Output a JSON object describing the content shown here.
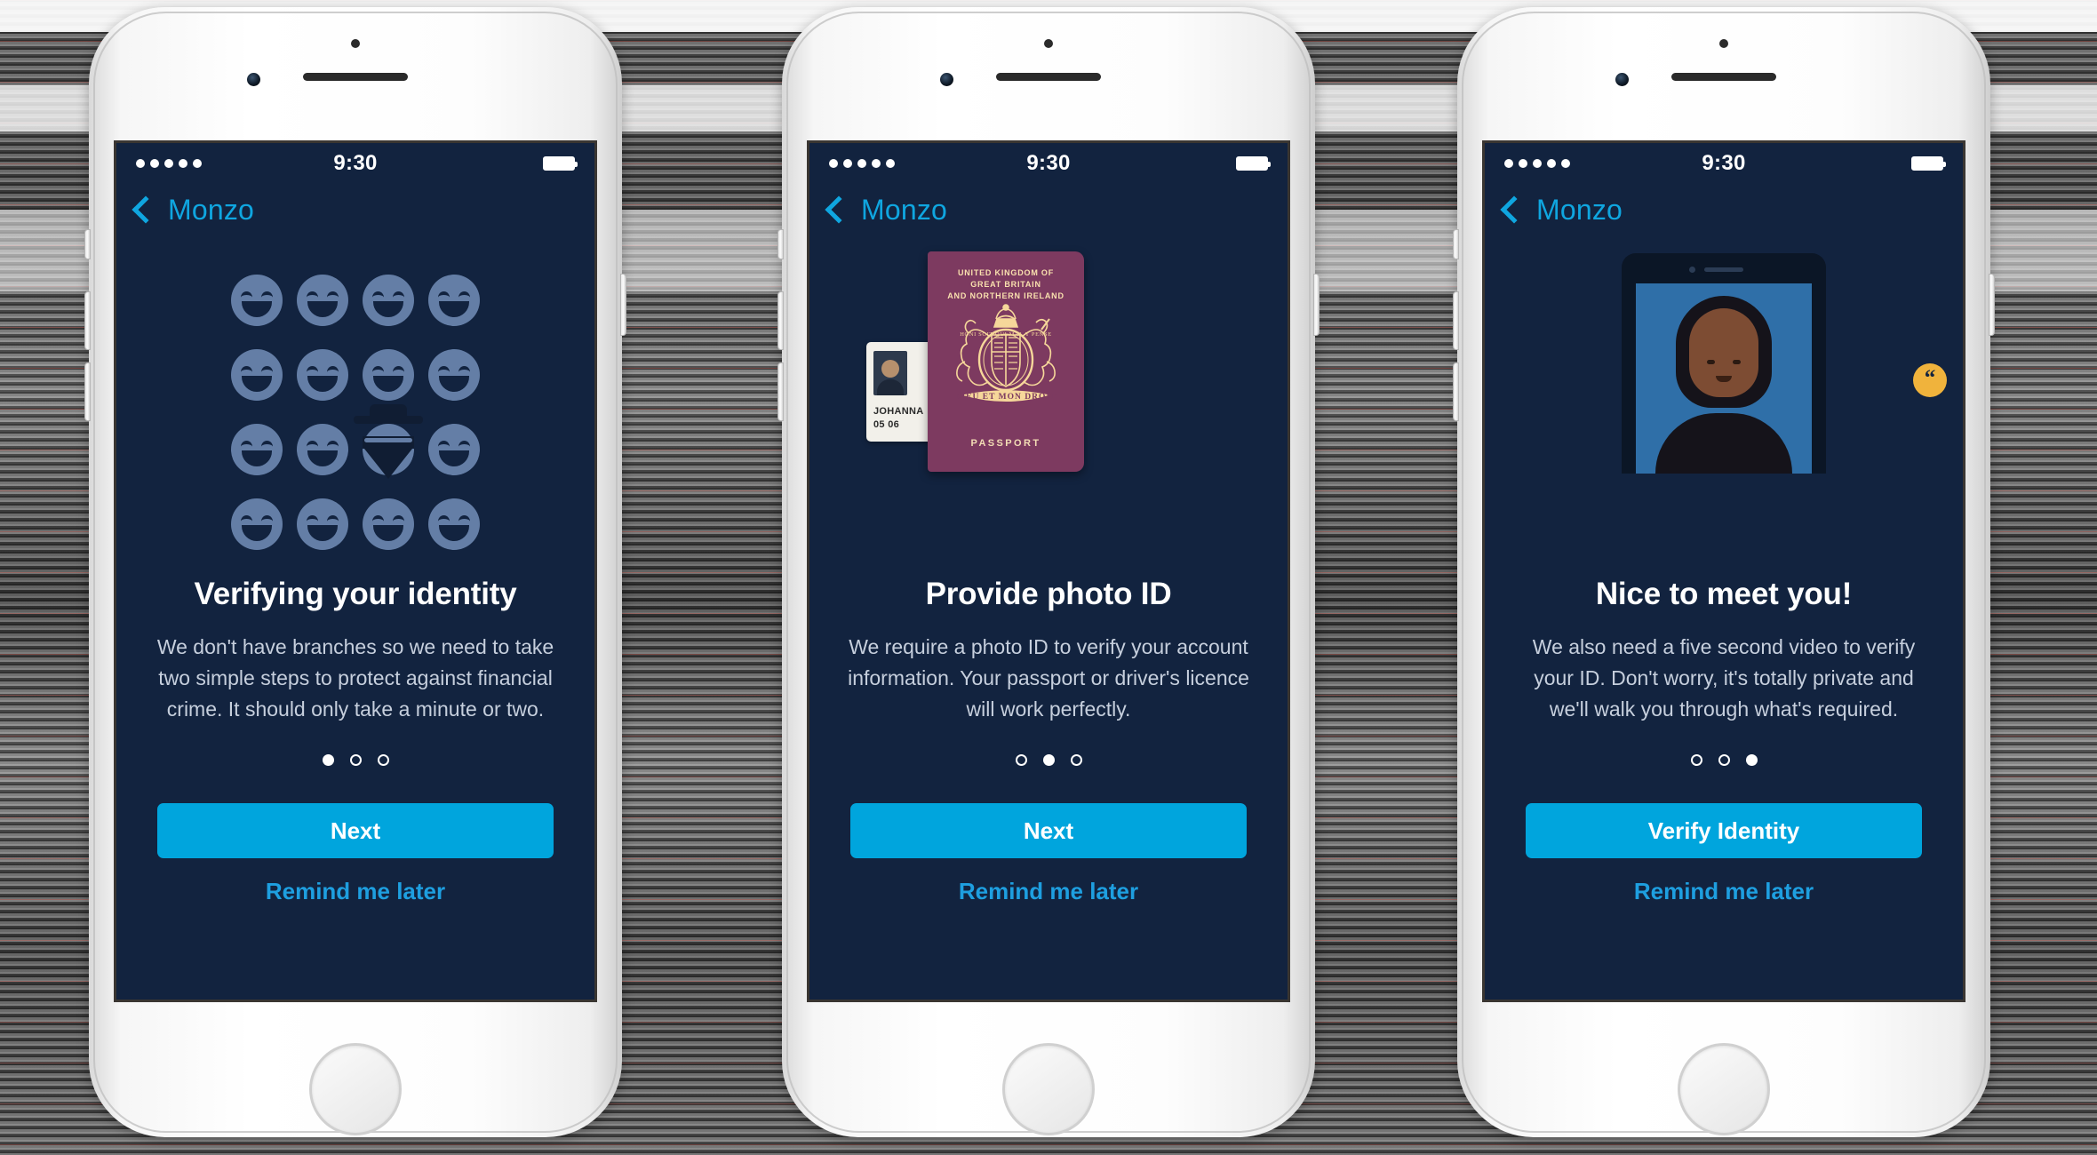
{
  "status_bar": {
    "signal_dots": 5,
    "time": "9:30",
    "battery": "full"
  },
  "nav": {
    "back_label": "Monzo"
  },
  "colors": {
    "screen_bg": "#12233f",
    "accent_cyan": "#00a5dd",
    "link_blue": "#1e9fe0",
    "face_blue": "#647ea6",
    "passport_maroon": "#7d3a60",
    "passport_gold": "#f6d79a",
    "bubble_yellow": "#f0b33c"
  },
  "screens": [
    {
      "id": "verify-identity",
      "illustration": "face-grid",
      "title": "Verifying your identity",
      "body": "We don't have branches so we need to take two simple steps to protect against financial crime. It should only take a minute or two.",
      "dots": {
        "count": 3,
        "active": 0
      },
      "primary_button": "Next",
      "secondary_button": "Remind me later"
    },
    {
      "id": "provide-photo-id",
      "illustration": "passport",
      "title": "Provide photo ID",
      "body": "We require a photo ID to verify your account information. Your passport or driver's licence will work perfectly.",
      "dots": {
        "count": 3,
        "active": 1
      },
      "primary_button": "Next",
      "secondary_button": "Remind me later"
    },
    {
      "id": "nice-to-meet-you",
      "illustration": "selfie-video",
      "title": "Nice to meet you!",
      "body": "We also need a five second video to verify your ID. Don't worry, it's totally private and we'll walk you through what's required.",
      "dots": {
        "count": 3,
        "active": 2
      },
      "primary_button": "Verify Identity",
      "secondary_button": "Remind me later"
    }
  ],
  "illustrations": {
    "face_grid": {
      "rows": 4,
      "cols": 4,
      "burglar_index": 10
    },
    "passport": {
      "header_line_1": "UNITED KINGDOM OF",
      "header_line_2": "GREAT BRITAIN",
      "header_line_3": "AND NORTHERN IRELAND",
      "footer": "PASSPORT",
      "motto": "DIEU ET MON DROIT",
      "garter": "HONI SOIT QUI MAL Y PENSE",
      "id_card_name": "JOHANNA",
      "id_card_date": "05 06"
    },
    "selfie": {
      "bubble_glyph": "“"
    }
  }
}
